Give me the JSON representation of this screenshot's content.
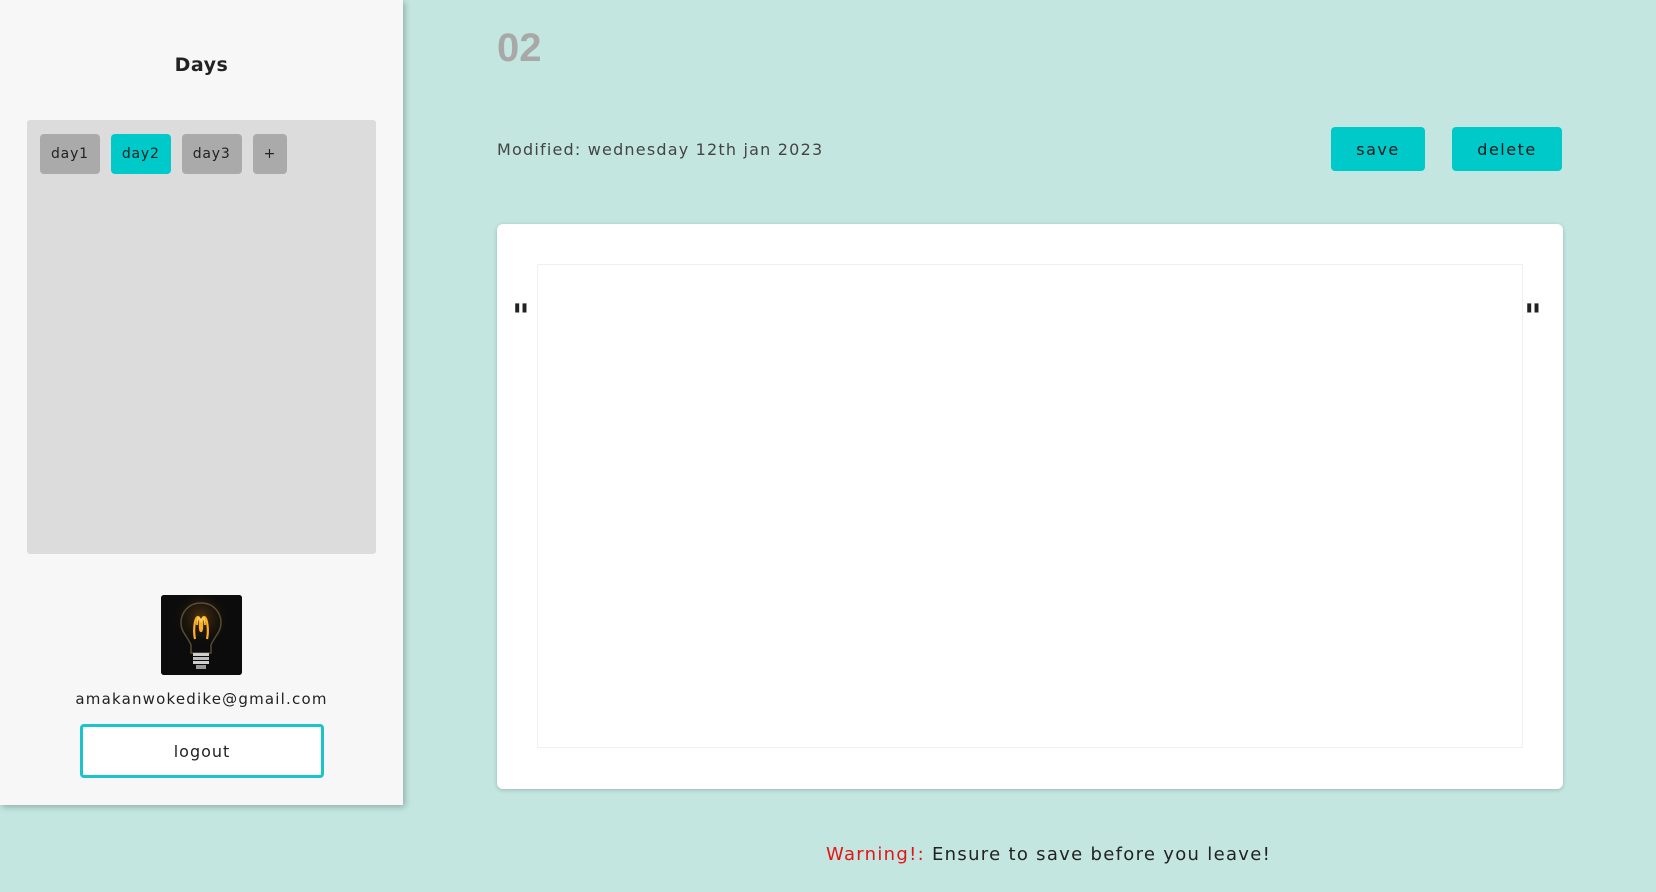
{
  "sidebar": {
    "title": "Days",
    "days": [
      {
        "label": "day1",
        "active": false
      },
      {
        "label": "day2",
        "active": true
      },
      {
        "label": "day3",
        "active": false
      }
    ],
    "add_label": "+",
    "avatar_icon": "lightbulb-icon",
    "email": "amakanwokedike@gmail.com",
    "logout_label": "logout"
  },
  "main": {
    "page_number": "02",
    "modified": "Modified: wednesday 12th jan 2023",
    "save_label": "save",
    "delete_label": "delete",
    "open_quote": "\"",
    "close_quote": "\"",
    "editor_value": ""
  },
  "footer": {
    "warning_label": "Warning!:",
    "warning_text": " Ensure to save before you leave!"
  },
  "colors": {
    "background": "#c3e6e0",
    "accent": "#00c9c9",
    "inactive_tab": "#aaaaaa",
    "warning": "#e51414"
  }
}
